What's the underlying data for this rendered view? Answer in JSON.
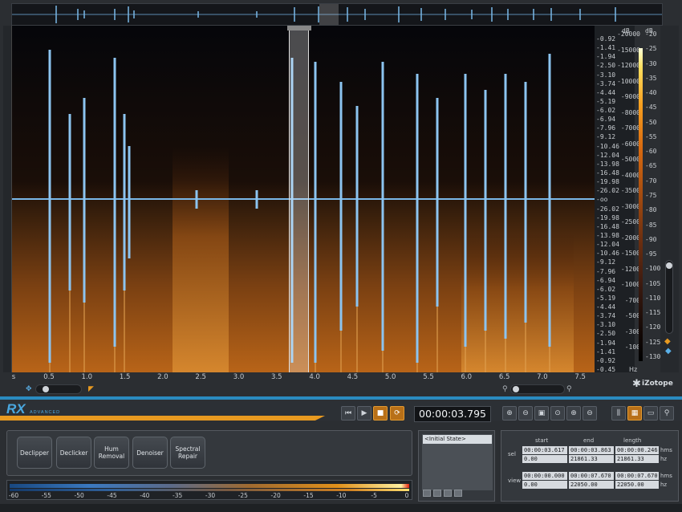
{
  "app": {
    "logo": "RX",
    "logo_sub": "ADVANCED",
    "brand": "iZotope"
  },
  "scale": {
    "left_unit": "dB",
    "left_ticks": [
      "-0.92",
      "-1.41",
      "-1.94",
      "-2.50",
      "-3.10",
      "-3.74",
      "-4.44",
      "-5.19",
      "-6.02",
      "-6.94",
      "-7.96",
      "-9.12",
      "-10.46",
      "-12.04",
      "-13.98",
      "-16.48",
      "-19.98",
      "-26.02",
      "-oo",
      "-26.02",
      "-19.98",
      "-16.48",
      "-13.98",
      "-12.04",
      "-10.46",
      "-9.12",
      "-7.96",
      "-6.94",
      "-6.02",
      "-5.19",
      "-4.44",
      "-3.74",
      "-3.10",
      "-2.50",
      "-1.94",
      "-1.41",
      "-0.92",
      "-0.45"
    ],
    "hz_ticks": [
      "-20000",
      "-15000",
      "-12000",
      "-10000",
      "-9000",
      "-8000",
      "-7000",
      "-6000",
      "-5000",
      "-4000",
      "-3500",
      "-3000",
      "-2500",
      "-2000",
      "-1500",
      "-1200",
      "-1000",
      "-700",
      "-500",
      "-300",
      "-100"
    ],
    "hz_unit": "Hz",
    "db_ticks": [
      "-20",
      "-25",
      "-30",
      "-35",
      "-40",
      "-45",
      "-50",
      "-55",
      "-60",
      "-65",
      "-70",
      "-75",
      "-80",
      "-85",
      "-90",
      "-95",
      "-100",
      "-105",
      "-110",
      "-115",
      "-120",
      "-125",
      "-130"
    ],
    "right_unit": "dB"
  },
  "time_axis": [
    "s",
    "0.5",
    "1.0",
    "1.5",
    "2.0",
    "2.5",
    "3.0",
    "3.5",
    "4.0",
    "4.5",
    "5.0",
    "5.5",
    "6.0",
    "6.5",
    "7.0",
    "7.5"
  ],
  "transport": {
    "buttons": [
      "skip-start-icon",
      "play-icon",
      "stop-icon",
      "loop-icon"
    ],
    "timecode": "00:00:03.795"
  },
  "zoom_tools": [
    "zoom-in-icon",
    "zoom-out-icon",
    "zoom-selection-icon",
    "zoom-fit-icon",
    "zoom-vertical-in-icon",
    "zoom-vertical-out-icon",
    "zoom-reset-icon"
  ],
  "view_tools": [
    "waveform-view-icon",
    "spectrogram-view-icon",
    "toggle-view-icon",
    "search-icon"
  ],
  "modules": [
    "Declipper",
    "Declicker",
    "Hum Removal",
    "Denoiser",
    "Spectral Repair"
  ],
  "meter_ticks": [
    "-60",
    "-55",
    "-50",
    "-45",
    "-40",
    "-35",
    "-30",
    "-25",
    "-20",
    "-15",
    "-10",
    "-5",
    "0"
  ],
  "history": {
    "items": [
      "<Initial State>"
    ]
  },
  "info": {
    "headers": [
      "start",
      "end",
      "length"
    ],
    "sel_label": "sel",
    "view_label": "view",
    "sel_hms": [
      "00:00:03.617",
      "00:00:03.863",
      "00:00:00.246"
    ],
    "sel_hz": [
      "0.00",
      "21861.33",
      "21861.33"
    ],
    "view_hms": [
      "00:00:00.000",
      "00:00:07.670",
      "00:00:07.670"
    ],
    "view_hz": [
      "0.00",
      "22050.00",
      "22050.00"
    ],
    "unit_hms": "hms",
    "unit_hz": "hz"
  },
  "colors": {
    "waveform": "#7ab8e8",
    "spectrogram_warm": "#c8701a",
    "accent_blue": "#2a8bc0",
    "accent_orange": "#e89a20"
  }
}
